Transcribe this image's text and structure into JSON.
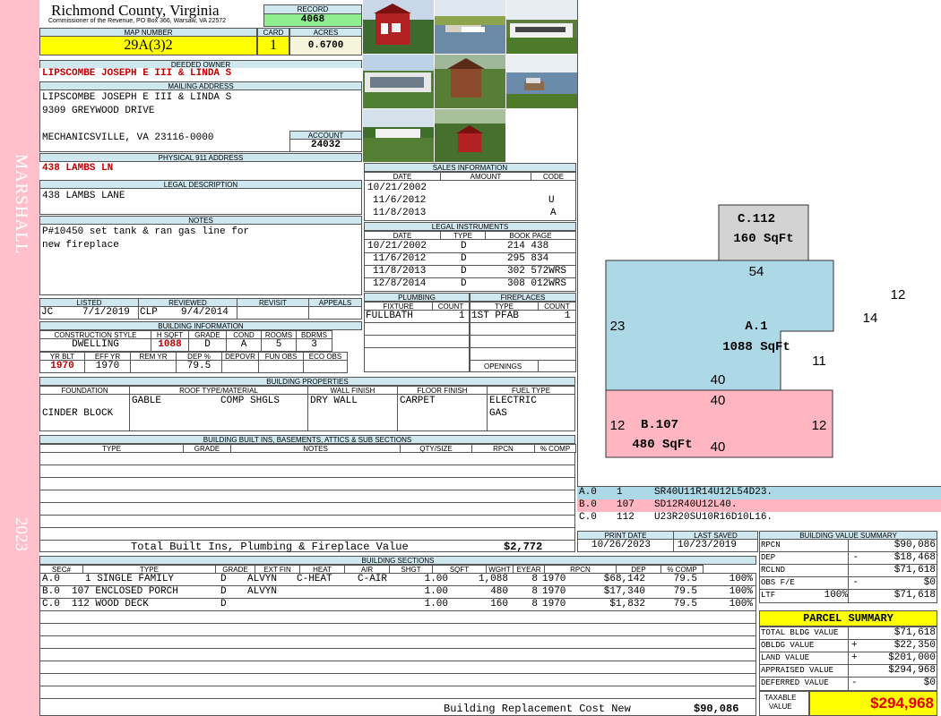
{
  "side_strip": {
    "top": "MARSHALL",
    "bottom": "2023"
  },
  "header": {
    "county": "Richmond County, Virginia",
    "commissioner": "Commissioner of the Revenue, PO Box 366, Warsaw, VA 22572",
    "record_label": "RECORD",
    "record": "4068",
    "map_label": "MAP NUMBER",
    "map": "29A(3)2",
    "card_label": "CARD",
    "card": "1",
    "acres_label": "ACRES",
    "acres": "0.6700"
  },
  "owner": {
    "label": "DEEDED OWNER",
    "name": "LIPSCOMBE JOSEPH E III & LINDA S"
  },
  "mailing": {
    "label": "MAILING ADDRESS",
    "line1": "LIPSCOMBE JOSEPH E III & LINDA S",
    "line2": "9309 GREYWOOD DRIVE",
    "line3": "MECHANICSVILLE, VA 23116-0000",
    "account_label": "ACCOUNT",
    "account": "24032"
  },
  "physical": {
    "label": "PHYSICAL 911 ADDRESS",
    "address": "438 LAMBS LN"
  },
  "legal_desc": {
    "label": "LEGAL DESCRIPTION",
    "text": "438 LAMBS LANE"
  },
  "notes": {
    "label": "NOTES",
    "line1": "P#10450 set tank & ran gas line for",
    "line2": "new fireplace"
  },
  "sales": {
    "label": "SALES INFORMATION",
    "cols": [
      "DATE",
      "AMOUNT",
      "CODE"
    ],
    "rows": [
      {
        "date": "10/21/2002",
        "amount": "",
        "code": ""
      },
      {
        "date": "11/6/2012",
        "amount": "",
        "code": "U"
      },
      {
        "date": "11/8/2013",
        "amount": "",
        "code": "A"
      }
    ]
  },
  "instruments": {
    "label": "LEGAL INSTRUMENTS",
    "cols": [
      "DATE",
      "TYPE",
      "BOOK PAGE"
    ],
    "rows": [
      {
        "date": "10/21/2002",
        "type": "D",
        "book": "214 438"
      },
      {
        "date": "11/6/2012",
        "type": "D",
        "book": "295 834"
      },
      {
        "date": "11/8/2013",
        "type": "D",
        "book": "302 572WRS"
      },
      {
        "date": "12/8/2014",
        "type": "D",
        "book": "308 012WRS"
      }
    ]
  },
  "listed": {
    "labels": [
      "LISTED",
      "REVIEWED",
      "REVISIT",
      "APPEALS"
    ],
    "listed_by": "JC",
    "listed_date": "7/1/2019",
    "reviewed_by": "CLP",
    "reviewed_date": "9/4/2014"
  },
  "building_info": {
    "label": "BUILDING INFORMATION",
    "cols1": [
      "CONSTRUCTION STYLE",
      "H SQFT",
      "GRADE",
      "COND",
      "ROOMS",
      "BDRMS"
    ],
    "vals1": [
      "DWELLING",
      "1088",
      "D",
      "A",
      "5",
      "3"
    ],
    "cols2": [
      "YR BLT",
      "EFF YR",
      "REM YR",
      "DEP %",
      "DEPOVR",
      "FUN OBS",
      "ECO OBS"
    ],
    "vals2": [
      "1970",
      "1970",
      "",
      "79.5",
      "",
      "",
      ""
    ]
  },
  "plumbing": {
    "label": "PLUMBING",
    "cols": [
      "FIXTURE",
      "COUNT"
    ],
    "fixture": "FULLBATH",
    "count": "1"
  },
  "fireplaces": {
    "label": "FIREPLACES",
    "cols": [
      "TYPE",
      "COUNT"
    ],
    "type": "1ST PFAB",
    "count": "1",
    "openings_label": "OPENINGS"
  },
  "properties": {
    "label": "BUILDING PROPERTIES",
    "cols": [
      "FOUNDATION",
      "ROOF TYPE/MATERIAL",
      "WALL FINISH",
      "FLOOR FINISH",
      "FUEL TYPE"
    ],
    "foundation": "CINDER BLOCK",
    "roof_type": "GABLE",
    "roof_mat": "COMP SHGLS",
    "wall": "DRY WALL",
    "floor": "CARPET",
    "fuel1": "ELECTRIC",
    "fuel2": "GAS"
  },
  "builtins": {
    "label": "BUILDING BUILT INS, BASEMENTS, ATTICS & SUB SECTIONS",
    "cols": [
      "TYPE",
      "GRADE",
      "NOTES",
      "QTY/SIZE",
      "RPCN",
      "% COMP"
    ],
    "total_label": "Total Built Ins, Plumbing & Fireplace Value",
    "total": "$2,772"
  },
  "print": {
    "print_label": "PRINT DATE",
    "print_date": "10/26/2023",
    "saved_label": "LAST SAVED",
    "saved_date": "10/23/2019"
  },
  "sketch": {
    "labels": [
      {
        "t": "C.112",
        "id": "c_name"
      },
      {
        "t": "160 SqFt",
        "id": "c_area"
      },
      {
        "t": "54",
        "id": "a_top"
      },
      {
        "t": "12",
        "id": "a_r1"
      },
      {
        "t": "14",
        "id": "a_r2"
      },
      {
        "t": "23",
        "id": "a_left"
      },
      {
        "t": "A.1",
        "id": "a_name"
      },
      {
        "t": "1088 SqFt",
        "id": "a_area"
      },
      {
        "t": "11",
        "id": "a_r3"
      },
      {
        "t": "40",
        "id": "a_bot"
      },
      {
        "t": "40",
        "id": "b_top"
      },
      {
        "t": "12",
        "id": "b_left"
      },
      {
        "t": "B.107",
        "id": "b_name"
      },
      {
        "t": "12",
        "id": "b_right"
      },
      {
        "t": "480 SqFt",
        "id": "b_area"
      },
      {
        "t": "40",
        "id": "b_bot"
      }
    ],
    "colors": {
      "A": "#add8e6",
      "B": "#ffb6c1",
      "C": "#d3d3d3"
    },
    "legend": [
      {
        "code": "A.0",
        "n": "1",
        "vec": "SR40U11R14U12L54D23."
      },
      {
        "code": "B.0",
        "n": "107",
        "vec": "SD12R40U12L40."
      },
      {
        "code": "C.0",
        "n": "112",
        "vec": "U23R20SU10R16D10L16."
      }
    ]
  },
  "sections": {
    "label": "BUILDING SECTIONS",
    "cols": [
      "SEC#",
      "TYPE",
      "GRADE",
      "EXT FIN",
      "HEAT",
      "AIR",
      "SHGT",
      "SQFT",
      "WGHT",
      "EYEAR",
      "RPCN",
      "DEP",
      "% COMP"
    ],
    "rows": [
      {
        "sec": "A.0",
        "type": "1 SINGLE FAMILY",
        "grade": "D",
        "ext": "ALVYN",
        "heat": "C-HEAT",
        "air": "C-AIR",
        "shgt": "1.00",
        "sqft": "1,088",
        "wght": "8",
        "eyear": "1970",
        "rpcn": "$68,142",
        "dep": "79.5",
        "comp": "100%"
      },
      {
        "sec": "B.0",
        "type": "107 ENCLOSED PORCH",
        "grade": "D",
        "ext": "ALVYN",
        "heat": "",
        "air": "",
        "shgt": "1.00",
        "sqft": "480",
        "wght": "8",
        "eyear": "1970",
        "rpcn": "$17,340",
        "dep": "79.5",
        "comp": "100%"
      },
      {
        "sec": "C.0",
        "type": "112 WOOD DECK",
        "grade": "D",
        "ext": "",
        "heat": "",
        "air": "",
        "shgt": "1.00",
        "sqft": "160",
        "wght": "8",
        "eyear": "1970",
        "rpcn": "$1,832",
        "dep": "79.5",
        "comp": "100%"
      }
    ],
    "total_label": "Building Replacement Cost New",
    "total": "$90,086"
  },
  "bvs": {
    "label": "BUILDING VALUE SUMMARY",
    "rows": [
      {
        "k": "RPCN",
        "s": "",
        "v": "$90,086"
      },
      {
        "k": "DEP",
        "s": "-",
        "v": "$18,468"
      },
      {
        "k": "RCLND",
        "s": "",
        "v": "$71,618"
      },
      {
        "k": "OBS F/E",
        "s": "-",
        "v": "$0"
      },
      {
        "k": "LTF",
        "s": "100%",
        "v": "$71,618"
      }
    ]
  },
  "parcel": {
    "label": "PARCEL SUMMARY",
    "rows": [
      {
        "k": "TOTAL BLDG VALUE",
        "s": "",
        "v": "$71,618"
      },
      {
        "k": "OBLDG VALUE",
        "s": "+",
        "v": "$22,350"
      },
      {
        "k": "LAND VALUE",
        "s": "+",
        "v": "$201,000"
      },
      {
        "k": "APPRAISED VALUE",
        "s": "",
        "v": "$294,968"
      },
      {
        "k": "DEFERRED VALUE",
        "s": "-",
        "v": "$0"
      }
    ],
    "taxable_label1": "TAXABLE",
    "taxable_label2": "VALUE",
    "taxable": "$294,968"
  }
}
